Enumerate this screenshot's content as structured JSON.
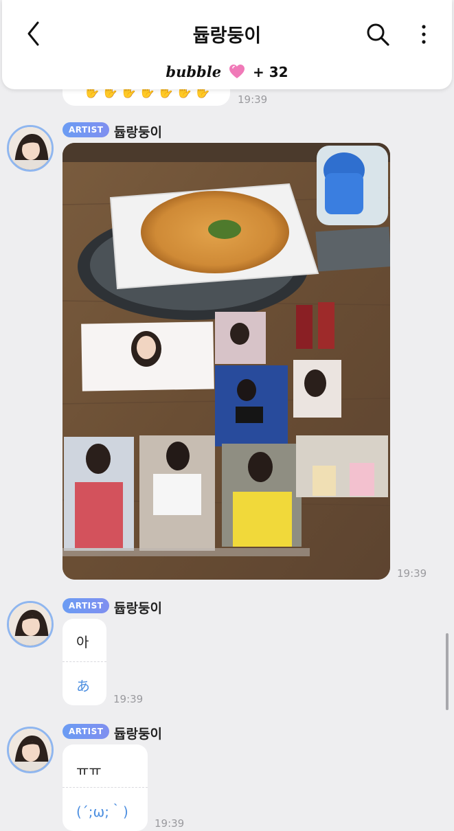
{
  "header": {
    "title": "듑랑둥이",
    "bubble_word": "bubble",
    "plus_count": "+ 32"
  },
  "messages": {
    "prev_time": "19:39",
    "photo": {
      "badge": "ARTIST",
      "name": "듑랑둥이",
      "time": "19:39"
    },
    "msg1": {
      "badge": "ARTIST",
      "name": "듑랑둥이",
      "text": "아",
      "translation": "あ",
      "time": "19:39"
    },
    "msg2": {
      "badge": "ARTIST",
      "name": "듑랑둥이",
      "text": "ㅠㅠ",
      "translation": "(´;ω;｀)",
      "time": "19:39"
    }
  },
  "colors": {
    "accent_blue": "#6b9cf3",
    "translation_blue": "#4d8fe0",
    "heart_pink": "#f07ab8",
    "background": "#eeeef0"
  },
  "icons": [
    "back-chevron-icon",
    "search-icon",
    "more-vertical-icon",
    "heart-icon"
  ]
}
